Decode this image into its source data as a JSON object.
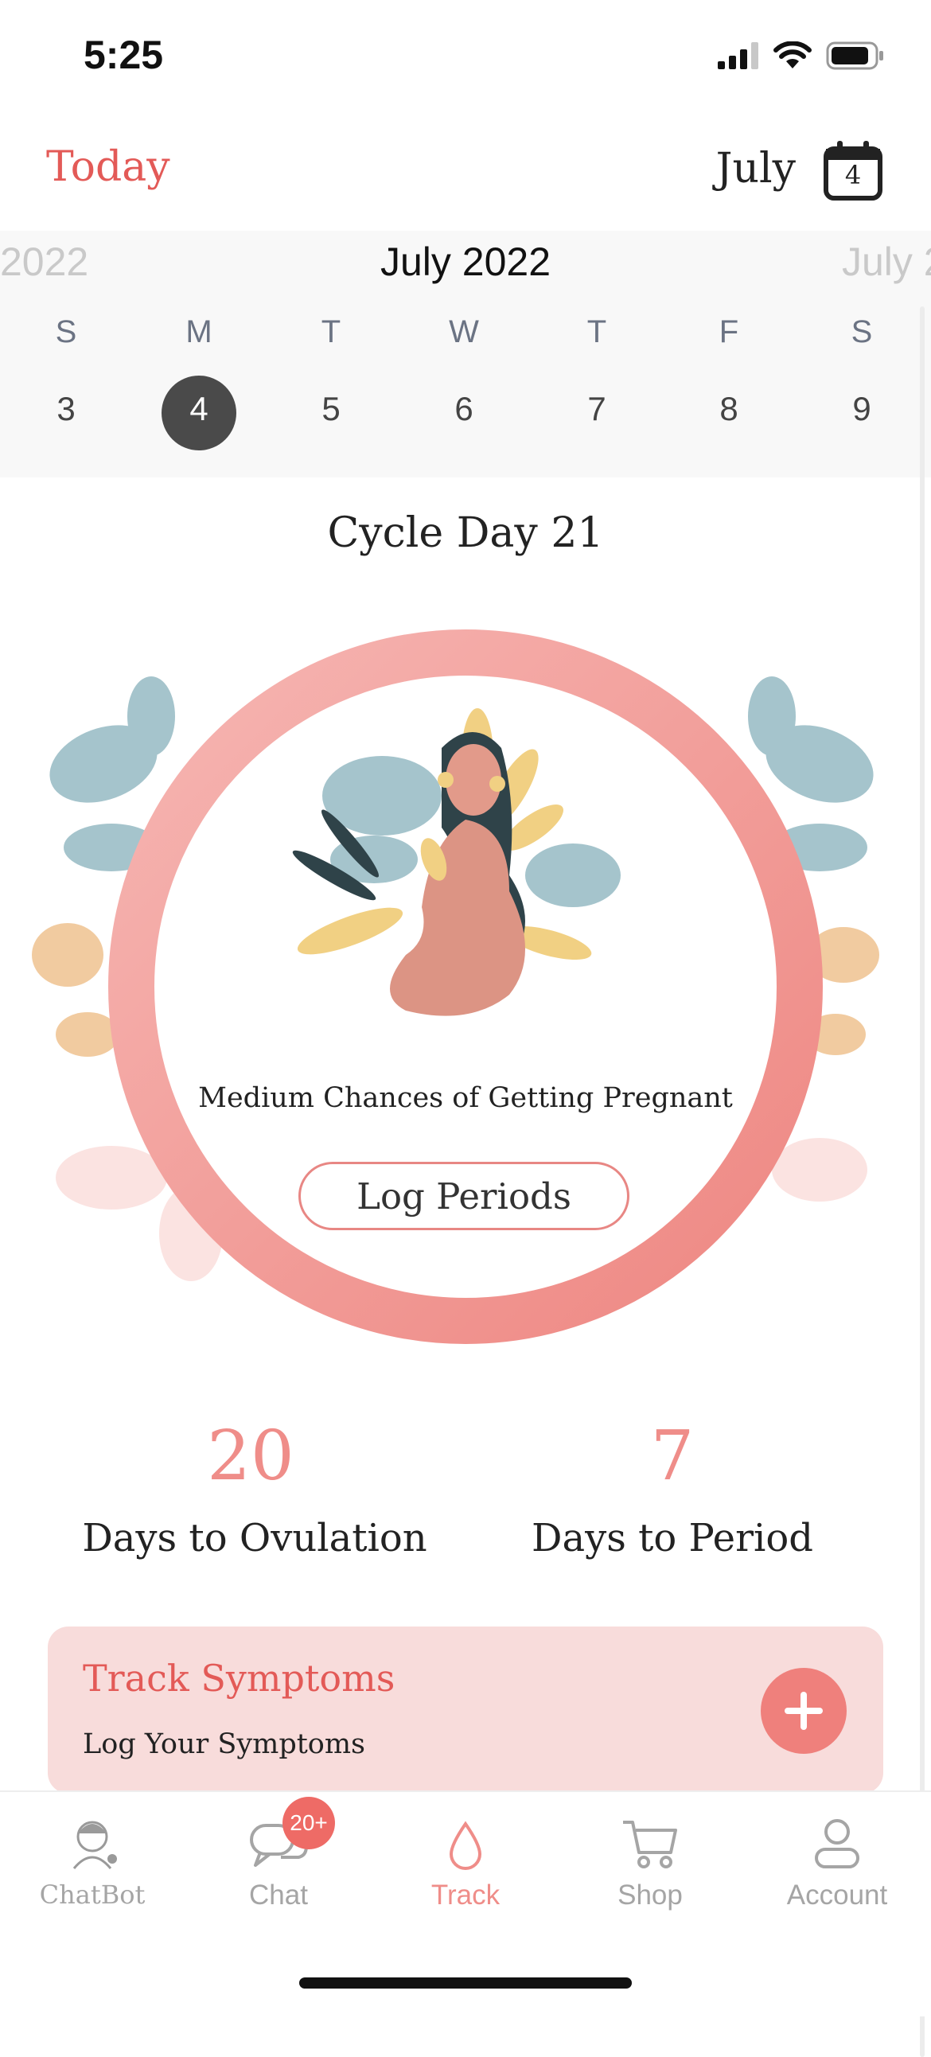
{
  "status_bar": {
    "time": "5:25"
  },
  "header": {
    "today_label": "Today",
    "month_label": "July",
    "calendar_day": "4"
  },
  "week_strip": {
    "prev_month": "2022",
    "current_month": "July 2022",
    "next_month": "July 2",
    "weekdays": [
      "S",
      "M",
      "T",
      "W",
      "T",
      "F",
      "S"
    ],
    "dates": [
      "3",
      "4",
      "5",
      "6",
      "7",
      "8",
      "9"
    ],
    "selected_date": "4"
  },
  "cycle": {
    "cycle_day_label": "Cycle Day 21",
    "chance_text": "Medium Chances of Getting Pregnant",
    "log_periods_label": "Log Periods"
  },
  "stats": {
    "ovulation_value": "20",
    "ovulation_label": "Days to Ovulation",
    "period_value": "7",
    "period_label": "Days to Period"
  },
  "symptoms": {
    "title": "Track Symptoms",
    "subtitle": "Log Your Symptoms"
  },
  "tabs": [
    {
      "label": "ChatBot",
      "icon": "chatbot-avatar-icon"
    },
    {
      "label": "Chat",
      "icon": "chat-bubbles-icon",
      "badge": "20+"
    },
    {
      "label": "Track",
      "icon": "drop-icon",
      "active": true
    },
    {
      "label": "Shop",
      "icon": "cart-icon"
    },
    {
      "label": "Account",
      "icon": "person-icon"
    }
  ],
  "colors": {
    "accent": "#e35a57",
    "ring": "#ef8d89",
    "card": "#f8dcdb",
    "selected_day": "#4a4a4a"
  }
}
